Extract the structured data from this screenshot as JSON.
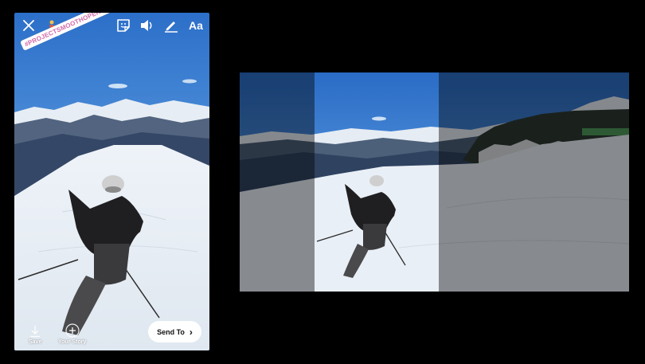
{
  "story_editor": {
    "hashtag": "#PROJECTSMOOTHOPERATOR",
    "icons": {
      "close": "close-icon",
      "sticker": "sticker-icon",
      "sound": "speaker-icon",
      "draw": "pen-icon",
      "text": "Aa"
    },
    "save_label": "Save",
    "your_story_label": "Your Story",
    "send_to_label": "Send To",
    "send_to_chevron": "›"
  },
  "crop_comparison": {
    "panels": [
      "dimmed-left",
      "story-crop",
      "dimmed-right"
    ]
  }
}
